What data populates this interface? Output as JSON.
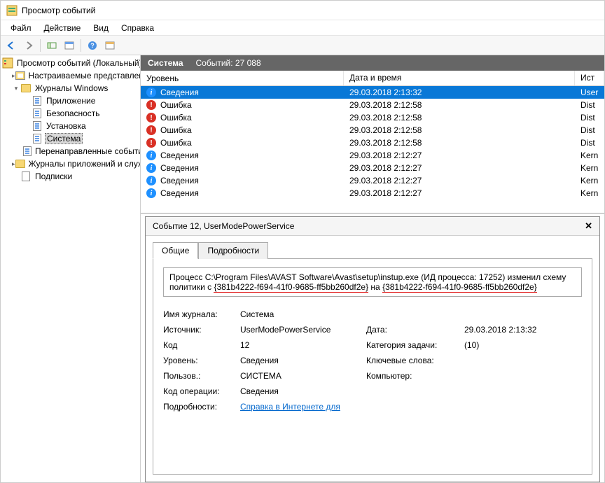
{
  "window": {
    "title": "Просмотр событий"
  },
  "menu": {
    "file": "Файл",
    "action": "Действие",
    "view": "Вид",
    "help": "Справка"
  },
  "tree": {
    "root": "Просмотр событий (Локальный)",
    "custom_views": "Настраиваемые представления",
    "win_logs": "Журналы Windows",
    "children": {
      "app": "Приложение",
      "security": "Безопасность",
      "setup": "Установка",
      "system": "Система",
      "forwarded": "Перенаправленные события"
    },
    "app_logs": "Журналы приложений и служб",
    "subs": "Подписки"
  },
  "header": {
    "title": "Система",
    "events_label": "Событий: 27 088"
  },
  "columns": {
    "level": "Уровень",
    "date": "Дата и время",
    "source": "Ист"
  },
  "levels": {
    "info": "Сведения",
    "error": "Ошибка"
  },
  "rows": [
    {
      "level": "info",
      "date": "29.03.2018 2:13:32",
      "src": "User",
      "selected": true
    },
    {
      "level": "error",
      "date": "29.03.2018 2:12:58",
      "src": "Dist"
    },
    {
      "level": "error",
      "date": "29.03.2018 2:12:58",
      "src": "Dist"
    },
    {
      "level": "error",
      "date": "29.03.2018 2:12:58",
      "src": "Dist"
    },
    {
      "level": "error",
      "date": "29.03.2018 2:12:58",
      "src": "Dist"
    },
    {
      "level": "info",
      "date": "29.03.2018 2:12:27",
      "src": "Kern"
    },
    {
      "level": "info",
      "date": "29.03.2018 2:12:27",
      "src": "Kern"
    },
    {
      "level": "info",
      "date": "29.03.2018 2:12:27",
      "src": "Kern"
    },
    {
      "level": "info",
      "date": "29.03.2018 2:12:27",
      "src": "Kern"
    }
  ],
  "detail": {
    "title": "Событие 12, UserModePowerService",
    "tabs": {
      "general": "Общие",
      "details": "Подробности"
    },
    "message_pre": "Процесс C:\\Program Files\\AVAST Software\\Avast\\setup\\instup.exe (ИД процесса: 17252) изменил схему политики с ",
    "guid1": "{381b4222-f694-41f0-9685-ff5bb260df2e}",
    "message_mid": " на ",
    "guid2": "{381b4222-f694-41f0-9685-ff5bb260df2e}",
    "labels": {
      "log_name": "Имя журнала:",
      "source": "Источник:",
      "date": "Дата:",
      "event_id": "Код",
      "task_cat": "Категория задачи:",
      "level": "Уровень:",
      "keywords": "Ключевые слова:",
      "user": "Пользов.:",
      "computer": "Компьютер:",
      "opcode": "Код операции:",
      "more": "Подробности:"
    },
    "values": {
      "log_name": "Система",
      "source": "UserModePowerService",
      "date": "29.03.2018 2:13:32",
      "event_id": "12",
      "task_cat": "(10)",
      "level": "Сведения",
      "keywords": "",
      "user": "СИСТЕМА",
      "computer": "",
      "opcode": "Сведения",
      "link": "Справка в Интернете для "
    }
  }
}
